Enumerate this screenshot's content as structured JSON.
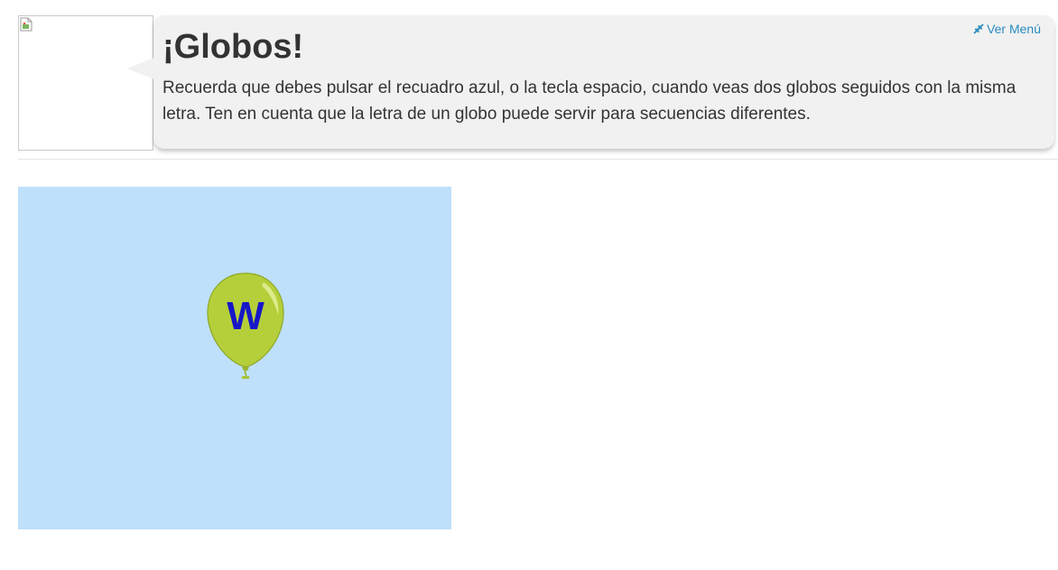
{
  "header": {
    "title": "¡Globos!",
    "instructions": "Recuerda que debes pulsar el recuadro azul, o la tecla espacio, cuando veas dos globos seguidos con la misma letra. Ten en cuenta que la letra de un globo puede servir para secuencias diferentes.",
    "menu_link_label": "Ver Menú",
    "menu_link_icon": "compress-arrows-icon",
    "avatar_icon": "broken-image-icon"
  },
  "game": {
    "area_color": "#bfe0fb",
    "balloon": {
      "letter": "W",
      "color": "#b5cf3a",
      "letter_color": "#1616c8"
    }
  },
  "colors": {
    "bubble_bg": "#f1f1f1",
    "link": "#2a8dc0",
    "text": "#333333"
  }
}
